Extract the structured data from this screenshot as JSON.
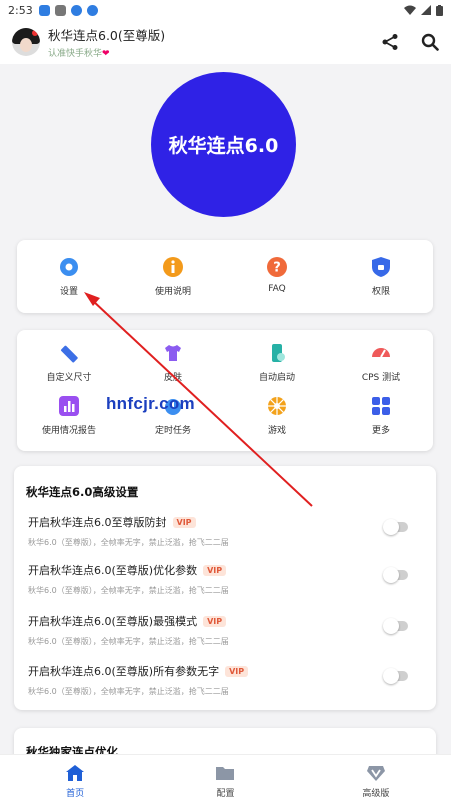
{
  "status_bar": {
    "time": "2:53"
  },
  "header": {
    "title": "秋华连点6.0(至尊版)",
    "subtitle": "认准快手秋华",
    "share_icon": "share-icon",
    "search_icon": "search-icon"
  },
  "logo": {
    "text": "秋华连点6.0"
  },
  "quick_menu": [
    {
      "label": "设置",
      "icon": "gear-icon",
      "color": "#3b8ef0"
    },
    {
      "label": "使用说明",
      "icon": "info-icon",
      "color": "#f39a1b"
    },
    {
      "label": "FAQ",
      "icon": "question-icon",
      "color": "#f06a3a"
    },
    {
      "label": "权限",
      "icon": "shield-icon",
      "color": "#3769e8"
    }
  ],
  "tools_menu": [
    {
      "label": "自定义尺寸",
      "icon": "ruler-icon",
      "color": "#3c6fe6"
    },
    {
      "label": "皮肤",
      "icon": "shirt-icon",
      "color": "#8b5cf0"
    },
    {
      "label": "自动启动",
      "icon": "phone-icon",
      "color": "#26b1a6"
    },
    {
      "label": "CPS 测试",
      "icon": "gauge-icon",
      "color": "#ef5a5a"
    },
    {
      "label": "使用情况报告",
      "icon": "chart-icon",
      "color": "#9a4ff0"
    },
    {
      "label": "定时任务",
      "icon": "timer-icon",
      "color": "#3b8ef0"
    },
    {
      "label": "游戏",
      "icon": "wheel-icon",
      "color": "#f3a21b"
    },
    {
      "label": "更多",
      "icon": "more-icon",
      "color": "#3b5ee8"
    }
  ],
  "advanced": {
    "title": "秋华连点6.0高级设置",
    "items": [
      {
        "label": "开启秋华连点6.0至尊版防封",
        "badge": "VIP",
        "desc": "秋华6.0（至尊版），全帧率无字，禁止泛滥，抢飞二二届"
      },
      {
        "label": "开启秋华连点6.0(至尊版)优化参数",
        "badge": "VIP",
        "desc": "秋华6.0（至尊版），全帧率无字，禁止泛滥，抢飞二二届"
      },
      {
        "label": "开启秋华连点6.0(至尊版)最强模式",
        "badge": "VIP",
        "desc": "秋华6.0（至尊版），全帧率无字，禁止泛滥，抢飞二二届"
      },
      {
        "label": "开启秋华连点6.0(至尊版)所有参数无字",
        "badge": "VIP",
        "desc": "秋华6.0（至尊版），全帧率无字，禁止泛滥，抢飞二二届"
      }
    ]
  },
  "next_section": {
    "title": "秋华独家连点优化"
  },
  "watermark": "hnfcjr.com",
  "bottom_nav": [
    {
      "label": "首页",
      "icon": "home-icon"
    },
    {
      "label": "配置",
      "icon": "folder-icon"
    },
    {
      "label": "高级版",
      "icon": "vip-icon"
    }
  ],
  "colors": {
    "accent": "#1f5fd6",
    "logo": "#2f22e6",
    "arrow": "#e02020",
    "vip_bg": "#fde4d9",
    "vip_text": "#e0593a"
  }
}
